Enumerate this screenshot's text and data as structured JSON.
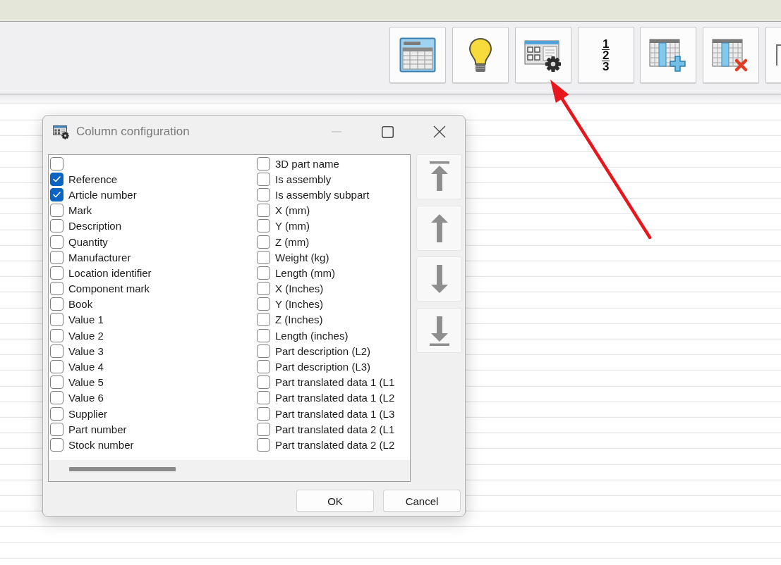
{
  "toolbar": {
    "buttons": [
      {
        "kind": "table"
      },
      {
        "kind": "bulb"
      },
      {
        "kind": "table-gear"
      },
      {
        "kind": "numbers",
        "glyphs": [
          "1",
          "2",
          "3"
        ]
      },
      {
        "kind": "add-column"
      },
      {
        "kind": "delete-column"
      },
      {
        "kind": "cut-off"
      }
    ]
  },
  "dialog": {
    "title": "Column configuration",
    "window_controls": [
      {
        "kind": "minimize",
        "disabled": true
      },
      {
        "kind": "maximize",
        "disabled": false
      },
      {
        "kind": "close",
        "disabled": false
      }
    ],
    "columns": [
      {
        "items": [
          {
            "checked": false
          },
          {
            "label": "Reference",
            "checked": true
          },
          {
            "label": "Article number",
            "checked": true
          },
          {
            "label": "Mark",
            "checked": false
          },
          {
            "label": "Description",
            "checked": false
          },
          {
            "label": "Quantity",
            "checked": false
          },
          {
            "label": "Manufacturer",
            "checked": false
          },
          {
            "label": "Location identifier",
            "checked": false
          },
          {
            "label": "Component mark",
            "checked": false
          },
          {
            "label": "Book",
            "checked": false
          },
          {
            "label": "Value 1",
            "checked": false
          },
          {
            "label": "Value 2",
            "checked": false
          },
          {
            "label": "Value 3",
            "checked": false
          },
          {
            "label": "Value 4",
            "checked": false
          },
          {
            "label": "Value 5",
            "checked": false
          },
          {
            "label": "Value 6",
            "checked": false
          },
          {
            "label": "Supplier",
            "checked": false
          },
          {
            "label": "Part number",
            "checked": false
          },
          {
            "label": "Stock number",
            "checked": false
          }
        ]
      },
      {
        "items": [
          {
            "label": "3D part name",
            "checked": false
          },
          {
            "label": "Is assembly",
            "checked": false
          },
          {
            "label": "Is assembly subpart",
            "checked": false
          },
          {
            "label": "X (mm)",
            "checked": false
          },
          {
            "label": "Y (mm)",
            "checked": false
          },
          {
            "label": "Z (mm)",
            "checked": false
          },
          {
            "label": "Weight (kg)",
            "checked": false
          },
          {
            "label": "Length (mm)",
            "checked": false
          },
          {
            "label": "X (Inches)",
            "checked": false
          },
          {
            "label": "Y (Inches)",
            "checked": false
          },
          {
            "label": "Z (Inches)",
            "checked": false
          },
          {
            "label": "Length (inches)",
            "checked": false
          },
          {
            "label": "Part description (L2)",
            "checked": false
          },
          {
            "label": "Part description (L3)",
            "checked": false
          },
          {
            "label": "Part translated data 1 (L1",
            "checked": false
          },
          {
            "label": "Part translated data 1 (L2",
            "checked": false
          },
          {
            "label": "Part translated data 1 (L3",
            "checked": false
          },
          {
            "label": "Part translated data 2 (L1",
            "checked": false
          },
          {
            "label": "Part translated data 2 (L2",
            "checked": false
          }
        ]
      }
    ],
    "move_buttons": [
      {
        "kind": "top"
      },
      {
        "kind": "up"
      },
      {
        "kind": "down"
      },
      {
        "kind": "bottom"
      }
    ],
    "buttons": [
      {
        "label": "OK"
      },
      {
        "label": "Cancel"
      }
    ]
  },
  "annotations": [
    {
      "kind": "arrow"
    }
  ]
}
